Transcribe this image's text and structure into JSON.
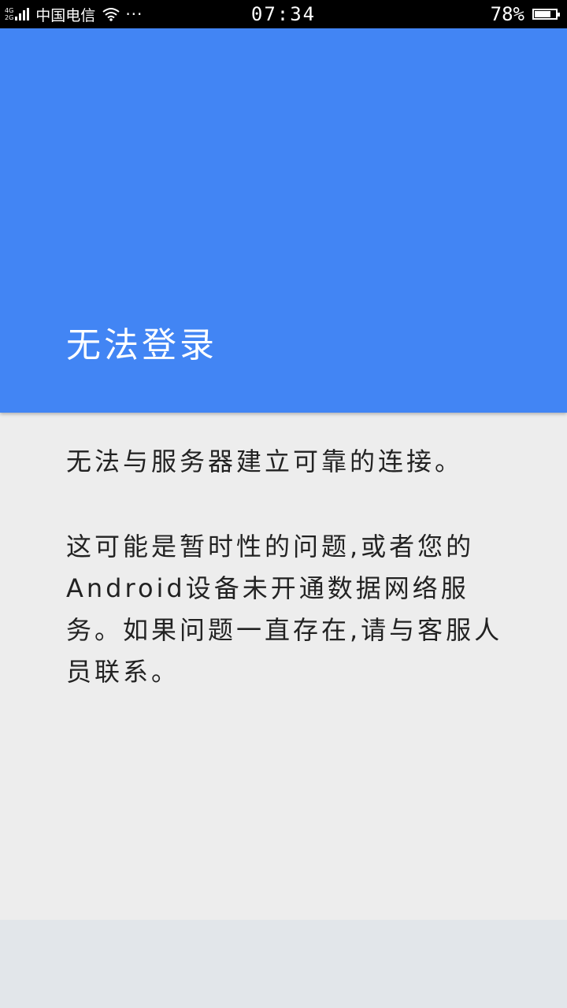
{
  "status_bar": {
    "network_type_top": "4G",
    "network_type_bottom": "2G",
    "carrier": "中国电信",
    "more": "···",
    "time": "07:34",
    "battery": "78%",
    "battery_level": 0.78
  },
  "header": {
    "title": "无法登录"
  },
  "body": {
    "message": "无法与服务器建立可靠的连接。",
    "detail": "这可能是暂时性的问题,或者您的Android设备未开通数据网络服务。如果问题一直存在,请与客服人员联系。"
  }
}
